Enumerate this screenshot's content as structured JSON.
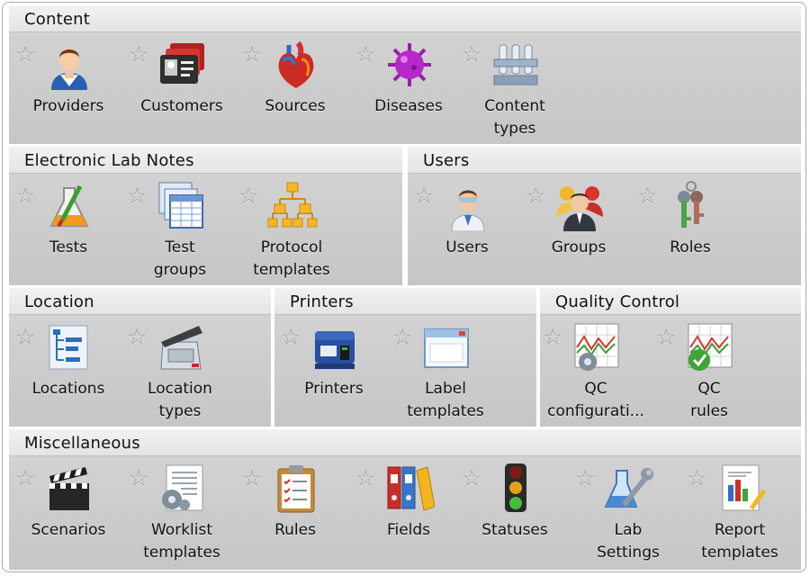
{
  "sections": {
    "content": {
      "title": "Content",
      "items": [
        {
          "line1": "Providers",
          "line2": "",
          "icon": "provider-person-icon"
        },
        {
          "line1": "Customers",
          "line2": "",
          "icon": "customer-id-card-icon"
        },
        {
          "line1": "Sources",
          "line2": "",
          "icon": "heart-organ-icon"
        },
        {
          "line1": "Diseases",
          "line2": "",
          "icon": "virus-icon"
        },
        {
          "line1": "Content",
          "line2": "types",
          "icon": "test-tube-rack-icon"
        }
      ]
    },
    "eln": {
      "title": "Electronic Lab Notes",
      "items": [
        {
          "line1": "Tests",
          "line2": "",
          "icon": "flask-icon"
        },
        {
          "line1": "Test",
          "line2": "groups",
          "icon": "spreadsheet-stack-icon"
        },
        {
          "line1": "Protocol",
          "line2": "templates",
          "icon": "hierarchy-icon"
        }
      ]
    },
    "users": {
      "title": "Users",
      "items": [
        {
          "line1": "Users",
          "line2": "",
          "icon": "scientist-user-icon"
        },
        {
          "line1": "Groups",
          "line2": "",
          "icon": "user-group-icon"
        },
        {
          "line1": "Roles",
          "line2": "",
          "icon": "keys-icon"
        }
      ]
    },
    "location": {
      "title": "Location",
      "items": [
        {
          "line1": "Locations",
          "line2": "",
          "icon": "location-tree-icon"
        },
        {
          "line1": "Location",
          "line2": "types",
          "icon": "freezer-icon"
        }
      ]
    },
    "printers": {
      "title": "Printers",
      "items": [
        {
          "line1": "Printers",
          "line2": "",
          "icon": "label-printer-icon"
        },
        {
          "line1": "Label",
          "line2": "templates",
          "icon": "label-window-icon"
        }
      ]
    },
    "qc": {
      "title": "Quality Control",
      "items": [
        {
          "line1": "QC",
          "line2": "configurati...",
          "icon": "qc-chart-gear-icon"
        },
        {
          "line1": "QC",
          "line2": "rules",
          "icon": "qc-chart-check-icon"
        }
      ]
    },
    "misc": {
      "title": "Miscellaneous",
      "items": [
        {
          "line1": "Scenarios",
          "line2": "",
          "icon": "clapperboard-icon"
        },
        {
          "line1": "Worklist",
          "line2": "templates",
          "icon": "worklist-gear-icon"
        },
        {
          "line1": "Rules",
          "line2": "",
          "icon": "clipboard-checklist-icon"
        },
        {
          "line1": "Fields",
          "line2": "",
          "icon": "binders-icon"
        },
        {
          "line1": "Statuses",
          "line2": "",
          "icon": "traffic-light-icon"
        },
        {
          "line1": "Lab",
          "line2": "Settings",
          "icon": "flask-wrench-icon"
        },
        {
          "line1": "Report",
          "line2": "templates",
          "icon": "report-chart-icon"
        }
      ]
    }
  },
  "favorite_star": "☆",
  "colors": {
    "section_bg": "#cfcfcf",
    "header_bg": "#ececec",
    "star": "#9a9a9a"
  }
}
